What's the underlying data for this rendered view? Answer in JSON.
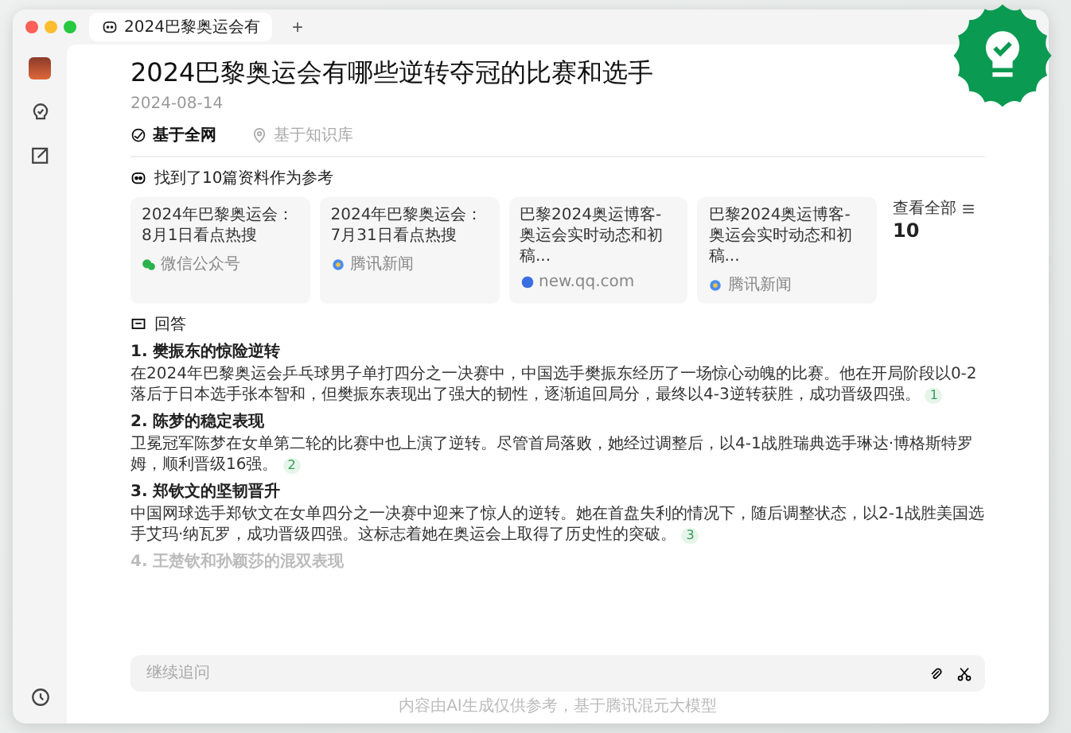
{
  "window": {
    "tab_title": "2024巴黎奥运会有",
    "new_tab": "+"
  },
  "article": {
    "title": "2024巴黎奥运会有哪些逆转夺冠的比赛和选手",
    "date": "2024-08-14",
    "source_tabs": [
      {
        "label": "基于全网",
        "selected": true,
        "kind": "web"
      },
      {
        "label": "基于知识库",
        "selected": false,
        "kind": "kb"
      }
    ],
    "references": {
      "heading": "找到了10篇资料作为参考",
      "cards": [
        {
          "title": "2024年巴黎奥运会：8月1日看点热搜",
          "source": "微信公众号",
          "kind": "wechat"
        },
        {
          "title": "2024年巴黎奥运会：7月31日看点热搜",
          "source": "腾讯新闻",
          "kind": "news"
        },
        {
          "title": "巴黎2024奥运博客-奥运会实时动态和初稿...",
          "source": "new.qq.com",
          "kind": "web"
        },
        {
          "title": "巴黎2024奥运博客-奥运会实时动态和初稿...",
          "source": "腾讯新闻",
          "kind": "news"
        }
      ],
      "view_all": {
        "label": "查看全部",
        "count": "10"
      }
    },
    "answer": {
      "heading": "回答",
      "items": [
        {
          "heading": "1. 樊振东的惊险逆转",
          "text": "在2024年巴黎奥运会乒乓球男子单打四分之一决赛中，中国选手樊振东经历了一场惊心动魄的比赛。他在开局阶段以0-2落后于日本选手张本智和，但樊振东表现出了强大的韧性，逐渐追回局分，最终以4-3逆转获胜，成功晋级四强。",
          "citation": "1",
          "faded": false
        },
        {
          "heading": "2. 陈梦的稳定表现",
          "text": "卫冕冠军陈梦在女单第二轮的比赛中也上演了逆转。尽管首局落败，她经过调整后，以4-1战胜瑞典选手琳达·博格斯特罗姆，顺利晋级16强。",
          "citation": "2",
          "faded": false
        },
        {
          "heading": "3. 郑钦文的坚韧晋升",
          "text": "中国网球选手郑钦文在女单四分之一决赛中迎来了惊人的逆转。她在首盘失利的情况下，随后调整状态，以2-1战胜美国选手艾玛·纳瓦罗，成功晋级四强。这标志着她在奥运会上取得了历史性的突破。",
          "citation": "3",
          "faded": false
        },
        {
          "heading": "4. 王楚钦和孙颖莎的混双表现",
          "faded": true
        }
      ]
    }
  },
  "input": {
    "placeholder": "继续追问"
  },
  "footer": "内容由AI生成仅供参考，基于腾讯混元大模型"
}
